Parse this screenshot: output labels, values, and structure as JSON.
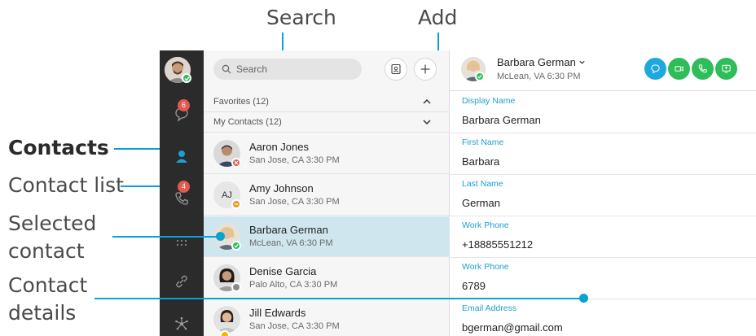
{
  "callouts": {
    "search": "Search",
    "add": "Add",
    "contacts": "Contacts",
    "contact_list": "Contact list",
    "selected_contact_line1": "Selected",
    "selected_contact_line2": "contact",
    "contact_details_line1": "Contact",
    "contact_details_line2": "details"
  },
  "accent_color": "#0aa1d4",
  "rail": {
    "messages_badge": "6",
    "calls_badge": "4"
  },
  "list": {
    "search_placeholder": "Search",
    "favorites_label": "Favorites (12)",
    "my_contacts_label": "My Contacts (12)",
    "contacts": [
      {
        "name": "Aaron Jones",
        "location": "San Jose, CA 3:30 PM",
        "status": "busy"
      },
      {
        "name": "Amy Johnson",
        "location": "San Jose, CA 3:30 PM",
        "initials": "AJ",
        "status": "dnd"
      },
      {
        "name": "Barbara German",
        "location": "McLean, VA 6:30 PM",
        "status": "available"
      },
      {
        "name": "Denise Garcia",
        "location": "Palo Alto, CA 3:30 PM",
        "status": "offline"
      },
      {
        "name": "Jill Edwards",
        "location": "San Jose, CA 3:30 PM",
        "status": "away"
      }
    ]
  },
  "detail": {
    "name": "Barbara German",
    "location": "McLean, VA 6:30 PM",
    "fields": [
      {
        "label": "Display Name",
        "value": "Barbara German"
      },
      {
        "label": "First Name",
        "value": "Barbara"
      },
      {
        "label": "Last Name",
        "value": "German"
      },
      {
        "label": "Work Phone",
        "value": "+18885551212"
      },
      {
        "label": "Work Phone",
        "value": "6789"
      },
      {
        "label": "Email Address",
        "value": "bgerman@gmail.com"
      }
    ],
    "action_colors": {
      "chat": "#1fa8de",
      "video": "#2ebd59",
      "call": "#2ebd59",
      "share": "#2ebd59"
    }
  }
}
